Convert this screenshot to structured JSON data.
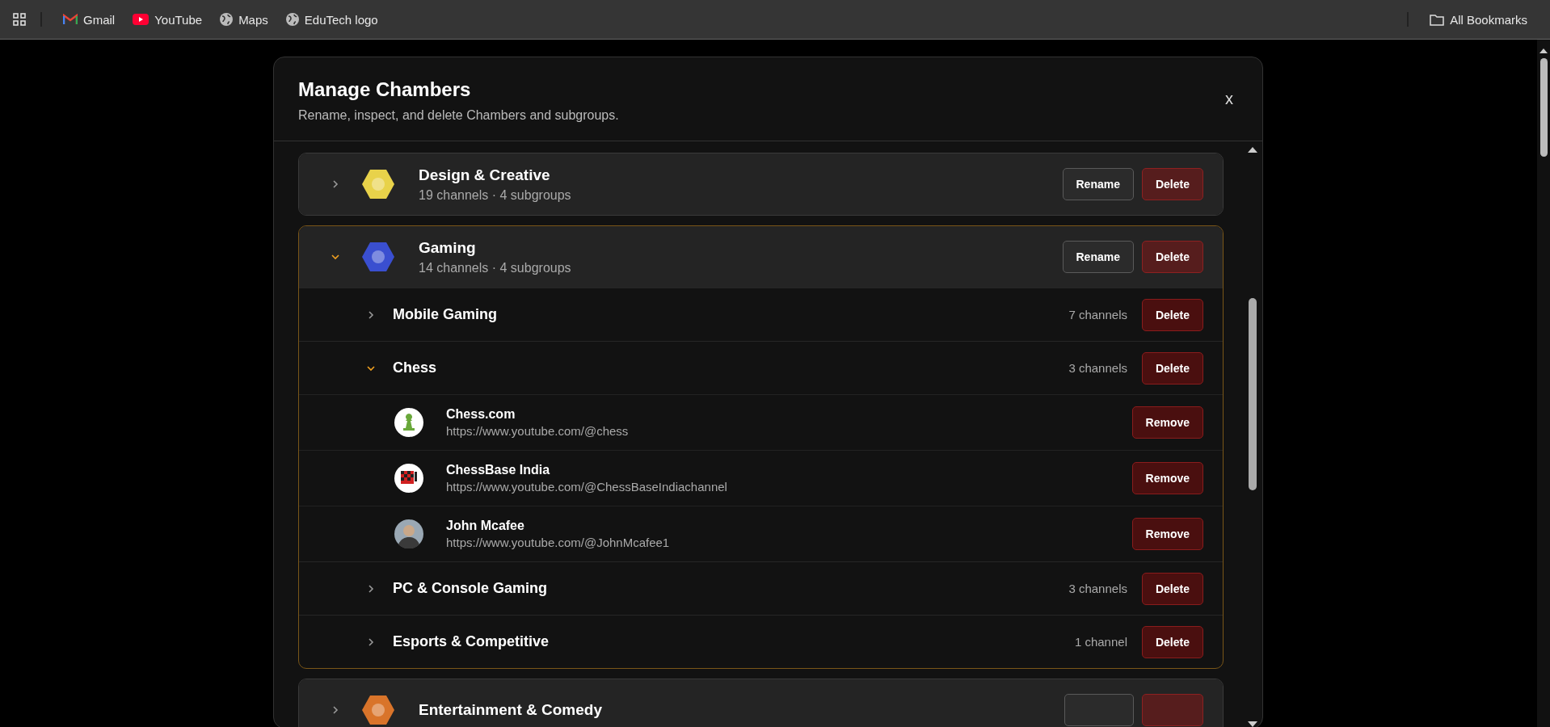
{
  "bookmarks_bar": {
    "items": [
      {
        "label": "Gmail",
        "kind": "mail"
      },
      {
        "label": "YouTube",
        "kind": "video"
      },
      {
        "label": "Maps",
        "kind": "site"
      },
      {
        "label": "EduTech logo",
        "kind": "site"
      }
    ],
    "all_bookmarks": "All Bookmarks"
  },
  "dialog": {
    "title": "Manage Chambers",
    "subtitle": "Rename, inspect, and delete Chambers and subgroups.",
    "close": "x",
    "chambers": [
      {
        "name": "Design & Creative",
        "summary": "19 channels · 4 subgroups",
        "expanded": false,
        "color": "#e8d24a",
        "rename_label": "Rename",
        "delete_label": "Delete"
      },
      {
        "name": "Gaming",
        "summary": "14 channels · 4 subgroups",
        "expanded": true,
        "color": "#3a4fd0",
        "rename_label": "Rename",
        "delete_label": "Delete",
        "subgroups": [
          {
            "name": "Mobile Gaming",
            "count": "7 channels",
            "expanded": false,
            "delete_label": "Delete"
          },
          {
            "name": "Chess",
            "count": "3 channels",
            "expanded": true,
            "delete_label": "Delete",
            "channels": [
              {
                "name": "Chess.com",
                "url": "https://www.youtube.com/@chess",
                "kind": "pawn",
                "remove_label": "Remove"
              },
              {
                "name": "ChessBase India",
                "url": "https://www.youtube.com/@ChessBaseIndiachannel",
                "kind": "board",
                "remove_label": "Remove"
              },
              {
                "name": "John Mcafee",
                "url": "https://www.youtube.com/@JohnMcafee1",
                "kind": "person",
                "remove_label": "Remove"
              }
            ]
          },
          {
            "name": "PC & Console Gaming",
            "count": "3 channels",
            "expanded": false,
            "delete_label": "Delete"
          },
          {
            "name": "Esports & Competitive",
            "count": "1 channel",
            "expanded": false,
            "delete_label": "Delete"
          }
        ]
      },
      {
        "name": "Entertainment & Comedy",
        "expanded": false,
        "color": "#d9742a"
      }
    ]
  }
}
